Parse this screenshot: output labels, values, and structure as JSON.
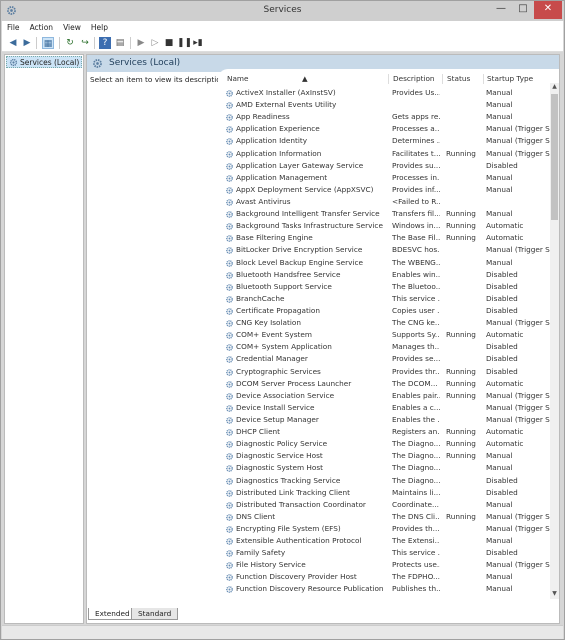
{
  "window": {
    "title": "Services"
  },
  "menu": [
    "File",
    "Action",
    "View",
    "Help"
  ],
  "tree": {
    "root": "Services (Local)"
  },
  "pane": {
    "header": "Services (Local)",
    "description": "Select an item to view its description."
  },
  "columns": {
    "name": "Name",
    "description": "Description",
    "status": "Status",
    "startup": "Startup Type"
  },
  "services": [
    {
      "name": "ActiveX Installer (AxInstSV)",
      "desc": "Provides Us...",
      "status": "",
      "startup": "Manual"
    },
    {
      "name": "AMD External Events Utility",
      "desc": "",
      "status": "",
      "startup": "Manual"
    },
    {
      "name": "App Readiness",
      "desc": "Gets apps re...",
      "status": "",
      "startup": "Manual"
    },
    {
      "name": "Application Experience",
      "desc": "Processes a...",
      "status": "",
      "startup": "Manual (Trigger S..."
    },
    {
      "name": "Application Identity",
      "desc": "Determines ...",
      "status": "",
      "startup": "Manual (Trigger S..."
    },
    {
      "name": "Application Information",
      "desc": "Facilitates t...",
      "status": "Running",
      "startup": "Manual (Trigger S..."
    },
    {
      "name": "Application Layer Gateway Service",
      "desc": "Provides su...",
      "status": "",
      "startup": "Disabled"
    },
    {
      "name": "Application Management",
      "desc": "Processes in...",
      "status": "",
      "startup": "Manual"
    },
    {
      "name": "AppX Deployment Service (AppXSVC)",
      "desc": "Provides inf...",
      "status": "",
      "startup": "Manual"
    },
    {
      "name": "Avast Antivirus",
      "desc": "<Failed to R...",
      "status": "",
      "startup": ""
    },
    {
      "name": "Background Intelligent Transfer Service",
      "desc": "Transfers fil...",
      "status": "Running",
      "startup": "Manual"
    },
    {
      "name": "Background Tasks Infrastructure Service",
      "desc": "Windows in...",
      "status": "Running",
      "startup": "Automatic"
    },
    {
      "name": "Base Filtering Engine",
      "desc": "The Base Fil...",
      "status": "Running",
      "startup": "Automatic"
    },
    {
      "name": "BitLocker Drive Encryption Service",
      "desc": "BDESVC hos...",
      "status": "",
      "startup": "Manual (Trigger S..."
    },
    {
      "name": "Block Level Backup Engine Service",
      "desc": "The WBENG...",
      "status": "",
      "startup": "Manual"
    },
    {
      "name": "Bluetooth Handsfree Service",
      "desc": "Enables win...",
      "status": "",
      "startup": "Disabled"
    },
    {
      "name": "Bluetooth Support Service",
      "desc": "The Bluetoo...",
      "status": "",
      "startup": "Disabled"
    },
    {
      "name": "BranchCache",
      "desc": "This service ...",
      "status": "",
      "startup": "Disabled"
    },
    {
      "name": "Certificate Propagation",
      "desc": "Copies user ...",
      "status": "",
      "startup": "Disabled"
    },
    {
      "name": "CNG Key Isolation",
      "desc": "The CNG ke...",
      "status": "",
      "startup": "Manual (Trigger S..."
    },
    {
      "name": "COM+ Event System",
      "desc": "Supports Sy...",
      "status": "Running",
      "startup": "Automatic"
    },
    {
      "name": "COM+ System Application",
      "desc": "Manages th...",
      "status": "",
      "startup": "Disabled"
    },
    {
      "name": "Credential Manager",
      "desc": "Provides se...",
      "status": "",
      "startup": "Disabled"
    },
    {
      "name": "Cryptographic Services",
      "desc": "Provides thr...",
      "status": "Running",
      "startup": "Disabled"
    },
    {
      "name": "DCOM Server Process Launcher",
      "desc": "The DCOM...",
      "status": "Running",
      "startup": "Automatic"
    },
    {
      "name": "Device Association Service",
      "desc": "Enables pair...",
      "status": "Running",
      "startup": "Manual (Trigger S..."
    },
    {
      "name": "Device Install Service",
      "desc": "Enables a c...",
      "status": "",
      "startup": "Manual (Trigger S..."
    },
    {
      "name": "Device Setup Manager",
      "desc": "Enables the ...",
      "status": "",
      "startup": "Manual (Trigger S..."
    },
    {
      "name": "DHCP Client",
      "desc": "Registers an...",
      "status": "Running",
      "startup": "Automatic"
    },
    {
      "name": "Diagnostic Policy Service",
      "desc": "The Diagno...",
      "status": "Running",
      "startup": "Automatic"
    },
    {
      "name": "Diagnostic Service Host",
      "desc": "The Diagno...",
      "status": "Running",
      "startup": "Manual"
    },
    {
      "name": "Diagnostic System Host",
      "desc": "The Diagno...",
      "status": "",
      "startup": "Manual"
    },
    {
      "name": "Diagnostics Tracking Service",
      "desc": "The Diagno...",
      "status": "",
      "startup": "Disabled"
    },
    {
      "name": "Distributed Link Tracking Client",
      "desc": "Maintains li...",
      "status": "",
      "startup": "Disabled"
    },
    {
      "name": "Distributed Transaction Coordinator",
      "desc": "Coordinate...",
      "status": "",
      "startup": "Manual"
    },
    {
      "name": "DNS Client",
      "desc": "The DNS Cli...",
      "status": "Running",
      "startup": "Manual (Trigger S..."
    },
    {
      "name": "Encrypting File System (EFS)",
      "desc": "Provides th...",
      "status": "",
      "startup": "Manual (Trigger S..."
    },
    {
      "name": "Extensible Authentication Protocol",
      "desc": "The Extensi...",
      "status": "",
      "startup": "Manual"
    },
    {
      "name": "Family Safety",
      "desc": "This service ...",
      "status": "",
      "startup": "Disabled"
    },
    {
      "name": "File History Service",
      "desc": "Protects use...",
      "status": "",
      "startup": "Manual (Trigger S..."
    },
    {
      "name": "Function Discovery Provider Host",
      "desc": "The FDPHO...",
      "status": "",
      "startup": "Manual"
    },
    {
      "name": "Function Discovery Resource Publication",
      "desc": "Publishes th...",
      "status": "",
      "startup": "Manual"
    }
  ],
  "tabs": [
    "Extended",
    "Standard"
  ]
}
